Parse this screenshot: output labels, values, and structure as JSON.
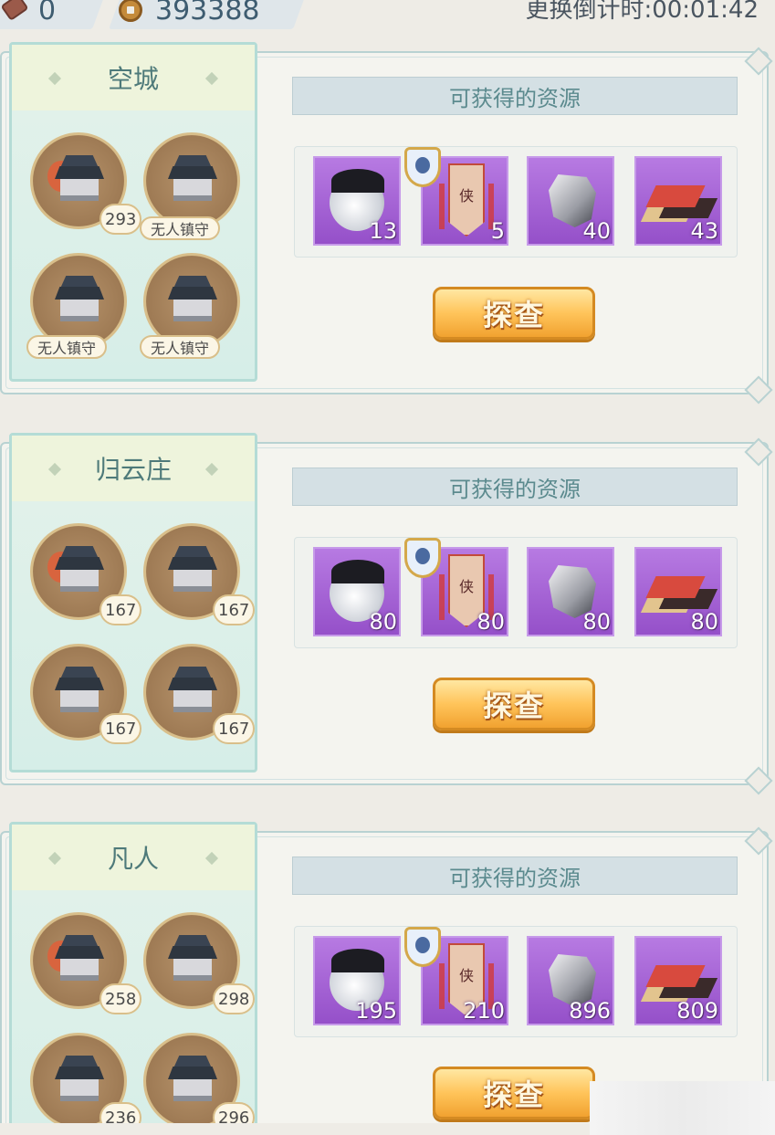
{
  "topbar": {
    "currency1_value": "0",
    "currency1_icon": "token-icon",
    "currency2_value": "393388",
    "currency2_icon": "copper-coin-icon",
    "countdown": "更换倒计时:00:01:42"
  },
  "regions": [
    {
      "name": "空城",
      "buildings": [
        {
          "icon": "red-tree-pavilion-icon",
          "count": "293"
        },
        {
          "icon": "dark-hall-icon",
          "count": "无人镇守"
        },
        {
          "icon": "pagoda-icon",
          "count": "无人镇守"
        },
        {
          "icon": "courtyard-icon",
          "count": "无人镇守"
        }
      ],
      "resources_title": "可获得的资源",
      "resources": [
        {
          "icon": "pearl-icon",
          "qty": "13"
        },
        {
          "icon": "xia-banner-icon",
          "qty": "5"
        },
        {
          "icon": "silver-ore-icon",
          "qty": "40"
        },
        {
          "icon": "cloth-bolt-icon",
          "qty": "43"
        }
      ],
      "button": "探查"
    },
    {
      "name": "归云庄",
      "buildings": [
        {
          "icon": "red-tree-pavilion-icon",
          "count": "167"
        },
        {
          "icon": "dark-hall-icon",
          "count": "167"
        },
        {
          "icon": "pagoda-icon",
          "count": "167"
        },
        {
          "icon": "courtyard-icon",
          "count": "167"
        }
      ],
      "resources_title": "可获得的资源",
      "resources": [
        {
          "icon": "pearl-icon",
          "qty": "80"
        },
        {
          "icon": "xia-banner-icon",
          "qty": "80"
        },
        {
          "icon": "silver-ore-icon",
          "qty": "80"
        },
        {
          "icon": "cloth-bolt-icon",
          "qty": "80"
        }
      ],
      "button": "探查"
    },
    {
      "name": "凡人",
      "buildings": [
        {
          "icon": "red-tree-pavilion-icon",
          "count": "258"
        },
        {
          "icon": "dark-hall-icon",
          "count": "298"
        },
        {
          "icon": "pagoda-icon",
          "count": "236"
        },
        {
          "icon": "courtyard-icon",
          "count": "296"
        }
      ],
      "resources_title": "可获得的资源",
      "resources": [
        {
          "icon": "pearl-icon",
          "qty": "195"
        },
        {
          "icon": "xia-banner-icon",
          "qty": "210"
        },
        {
          "icon": "silver-ore-icon",
          "qty": "896"
        },
        {
          "icon": "cloth-bolt-icon",
          "qty": "809"
        }
      ],
      "button": "探查"
    }
  ]
}
